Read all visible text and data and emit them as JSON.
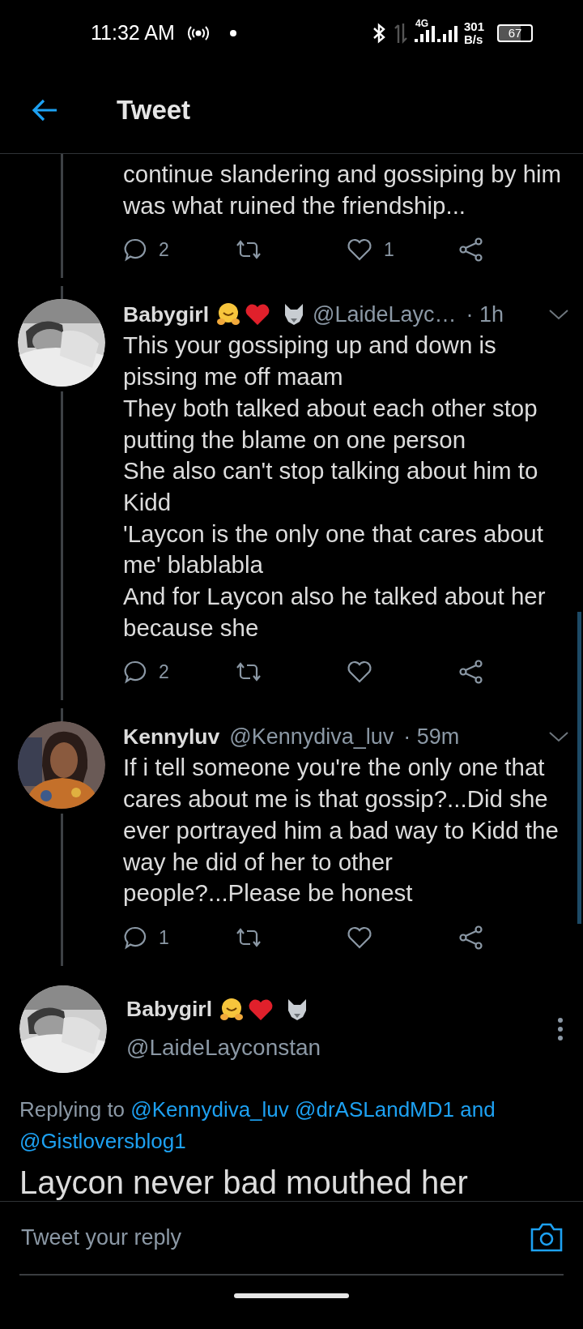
{
  "status_bar": {
    "time": "11:32 AM",
    "network_type": "4G",
    "speed_value": "301",
    "speed_unit": "B/s",
    "battery": "67"
  },
  "header": {
    "title": "Tweet"
  },
  "tweets": [
    {
      "kind": "continued",
      "paragraphs": [
        "continue slandering and gossiping by him was what ruined the friendship..."
      ],
      "replies": "2",
      "likes": "1"
    },
    {
      "kind": "reply",
      "name": "Babygirl",
      "has_emojis": true,
      "handle": "@LaideLayc…",
      "time": "· 1h",
      "paragraphs": [
        "This your gossiping up and down is pissing me off maam",
        "They both talked about each other stop putting the blame on one person",
        "She also can't stop talking about him to Kidd",
        "'Laycon is the only one that cares about me' blablabla",
        "And for Laycon also he talked about her because she"
      ],
      "replies": "2"
    },
    {
      "kind": "reply",
      "name": "Kennyluv",
      "has_emojis": false,
      "handle": "@Kennydiva_luv",
      "time": "· 59m",
      "paragraphs": [
        "If i tell someone you're the only one that cares about me is that gossip?...Did she ever portrayed him a bad way to Kidd the way he did of her to other people?...Please be honest"
      ],
      "replies": "1"
    }
  ],
  "focal": {
    "name": "Babygirl",
    "has_emojis": true,
    "handle": "@LaideLayconstan",
    "replying_prefix": "Replying to",
    "mentions": [
      "@Kennydiva_luv",
      "@drASLandMD1",
      "@Gistloversblog1"
    ],
    "conjunction": "and",
    "text": "Laycon never bad mouthed her"
  },
  "reply_bar": {
    "placeholder": "Tweet your reply"
  }
}
